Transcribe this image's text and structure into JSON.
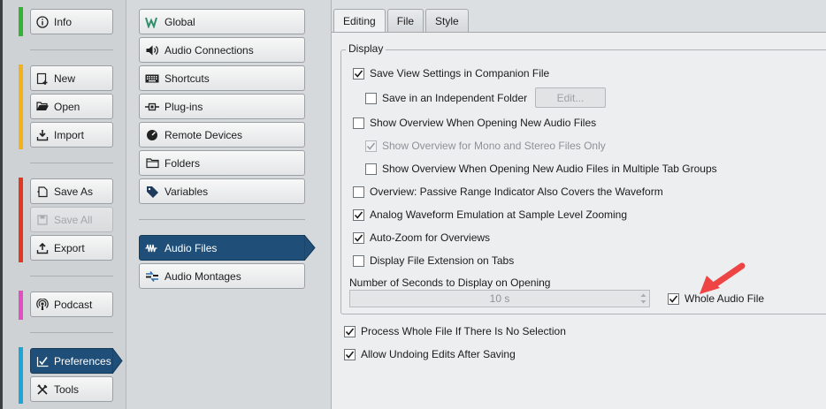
{
  "nav": {
    "info": "Info",
    "new": "New",
    "open": "Open",
    "import": "Import",
    "save_as": "Save As",
    "save_all": "Save All",
    "export": "Export",
    "podcast": "Podcast",
    "preferences": "Preferences",
    "tools": "Tools",
    "bar_colors": {
      "info": "#34b233",
      "file": "#f3b11b",
      "save": "#e1391f",
      "podcast": "#e14fc0",
      "prefs": "#1ea5d6"
    }
  },
  "categories": {
    "global": "Global",
    "audio_connections": "Audio Connections",
    "shortcuts": "Shortcuts",
    "plugins": "Plug-ins",
    "remote_devices": "Remote Devices",
    "folders": "Folders",
    "variables": "Variables",
    "audio_files": "Audio Files",
    "audio_montages": "Audio Montages"
  },
  "tabs": [
    "Editing",
    "File",
    "Style"
  ],
  "active_tab": "Editing",
  "display_group": {
    "label": "Display",
    "options": {
      "save_view": {
        "label": "Save View Settings in Companion File",
        "checked": true
      },
      "independent_folder": {
        "label": "Save in an Independent Folder",
        "checked": false
      },
      "edit_button": "Edit...",
      "show_overview": {
        "label": "Show Overview When Opening New Audio Files",
        "checked": false
      },
      "mono_stereo": {
        "label": "Show Overview for Mono and Stereo Files Only",
        "checked": true,
        "disabled": true
      },
      "multiple_tabs": {
        "label": "Show Overview When Opening New Audio Files in Multiple Tab Groups",
        "checked": false
      },
      "passive_range": {
        "label": "Overview: Passive Range Indicator Also Covers the Waveform",
        "checked": false
      },
      "analog_waveform": {
        "label": "Analog Waveform Emulation at Sample Level Zooming",
        "checked": true
      },
      "auto_zoom": {
        "label": "Auto-Zoom for Overviews",
        "checked": true
      },
      "file_extension": {
        "label": "Display File Extension on Tabs",
        "checked": false
      }
    },
    "seconds_label": "Number of Seconds to Display on Opening",
    "seconds_value": "10 s",
    "whole_audio_file": {
      "label": "Whole Audio File",
      "checked": true
    }
  },
  "process_whole_file": {
    "label": "Process Whole File If There Is No Selection",
    "checked": true
  },
  "allow_undoing": {
    "label": "Allow Undoing Edits After Saving",
    "checked": true
  },
  "annotation_color": "#ee4444"
}
